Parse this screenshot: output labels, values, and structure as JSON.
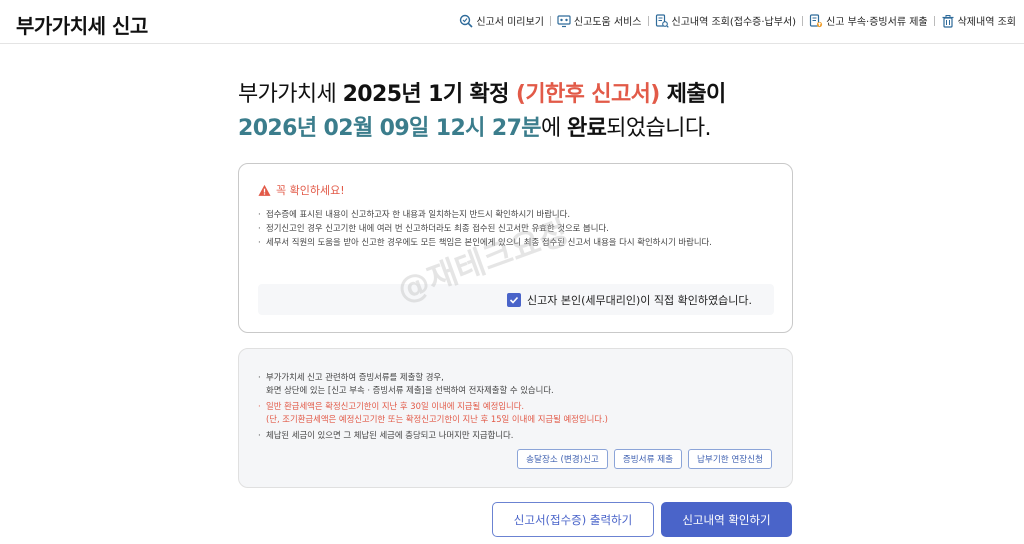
{
  "header": {
    "title": "부가가치세 신고",
    "nav": [
      {
        "label": "신고서 미리보기",
        "icon": "magnifier-document-icon"
      },
      {
        "label": "신고도움 서비스",
        "icon": "monitor-help-icon"
      },
      {
        "label": "신고내역 조회(접수증·납부서)",
        "icon": "document-search-icon"
      },
      {
        "label": "신고 부속·증빙서류 제출",
        "icon": "document-upload-icon"
      },
      {
        "label": "삭제내역 조회",
        "icon": "trash-icon"
      }
    ]
  },
  "headline": {
    "l1_prefix": "부가가치세 ",
    "l1_bold": "2025년 1기 확정 ",
    "l1_red": "(기한후 신고서)",
    "l1_suffix": " 제출이",
    "l2_date": "2026년 02월 09일 12시 27분",
    "l2_mid": "에 ",
    "l2_bold": "완료",
    "l2_suffix": "되었습니다."
  },
  "notice": {
    "title": "꼭 확인하세요!",
    "items": [
      "접수증에 표시된 내용이 신고하고자 한 내용과 일치하는지 반드시 확인하시기 바랍니다.",
      "정기신고인 경우 신고기한 내에 여러 번 신고하더라도 최종 접수된 신고서만 유효한 것으로 봅니다.",
      "세무서 직원의 도움을 받아 신고한 경우에도 모든 책임은 본인에게 있으니 최종 접수된 신고서 내용을 다시 확인하시기 바랍니다."
    ],
    "confirm_label": "신고자 본인(세무대리인)이 직접 확인하였습니다.",
    "confirm_checked": true
  },
  "info": {
    "item1_line1": "부가가치세 신고 관련하여 증빙서류를 제출할 경우,",
    "item1_line2": "화면 상단에 있는 [신고 부속 · 증빙서류 제출]을 선택하여 전자제출할 수 있습니다.",
    "item2_line1": "일반 환급세액은 확정신고기한이 지난 후 30일 이내에 지급될 예정입니다.",
    "item2_line2": "(단, 조기환급세액은 예정신고기한 또는 확정신고기한이 지난 후 15일 이내에 지급될 예정입니다.)",
    "item3": "체납된 세금이 있으면 그 체납된 세금에 충당되고 나머지만 지급합니다.",
    "buttons": [
      "송달장소 (변경)신고",
      "증빙서류 제출",
      "납부기한 연장신청"
    ]
  },
  "actions": {
    "print_label": "신고서(접수증) 출력하기",
    "confirm_label": "신고내역 확인하기"
  },
  "watermark": "@재테크요정",
  "colors": {
    "accent": "#4a64c9",
    "warning": "#e25a48",
    "date": "#3b7d8c"
  }
}
